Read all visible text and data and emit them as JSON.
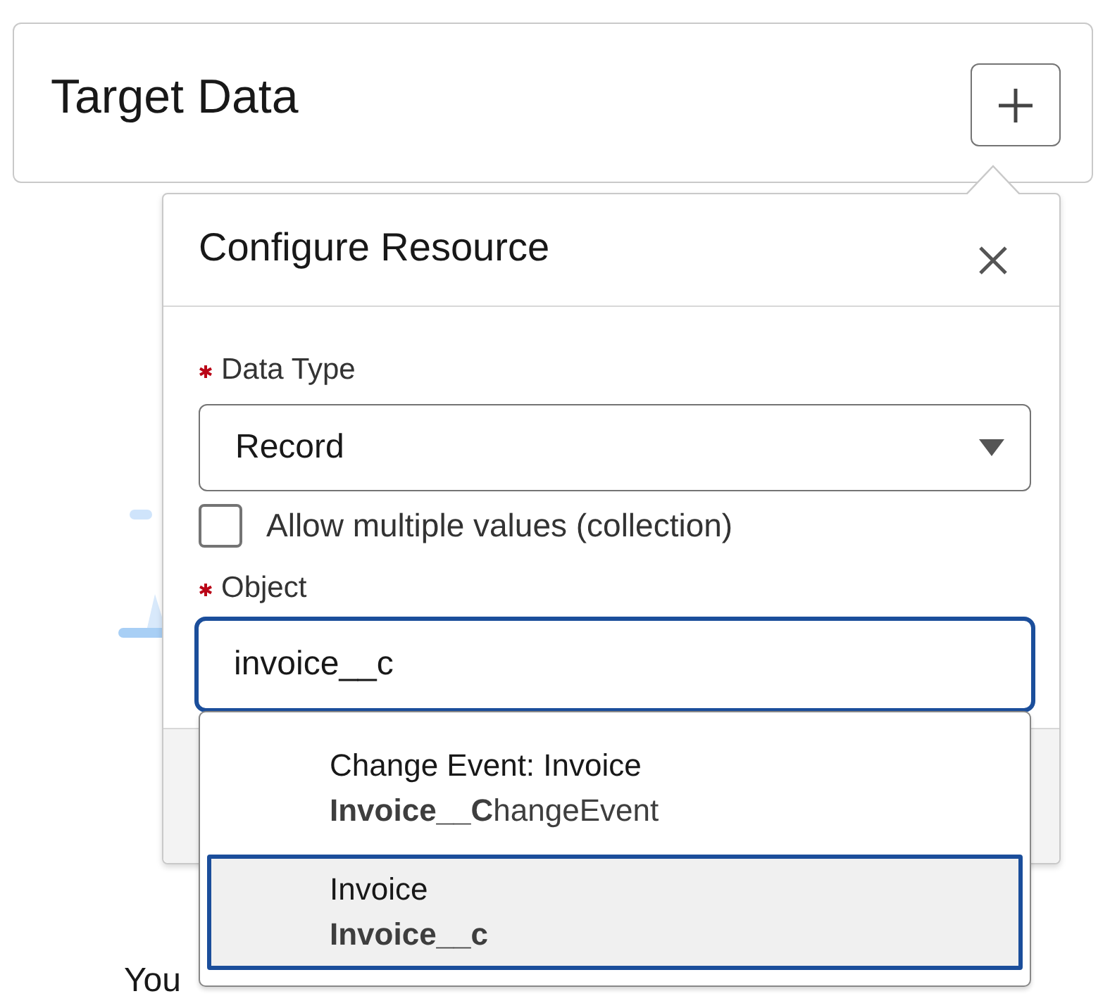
{
  "card": {
    "title": "Target Data"
  },
  "popover": {
    "title": "Configure Resource",
    "fields": [
      {
        "kind": "select",
        "label": "Data Type",
        "required": true,
        "value": "Record"
      },
      {
        "kind": "checkbox",
        "label": "Allow multiple values (collection)",
        "checked": false
      },
      {
        "kind": "combobox",
        "label": "Object",
        "required": true,
        "value": "invoice__c",
        "focused": true
      }
    ]
  },
  "options": [
    {
      "label": "Change Event: Invoice",
      "api_name": "**Invoice__C**hangeEvent",
      "selected": false
    },
    {
      "label": "Invoice",
      "api_name": "**Invoice__c**",
      "selected": true
    }
  ],
  "empty_message": "You"
}
